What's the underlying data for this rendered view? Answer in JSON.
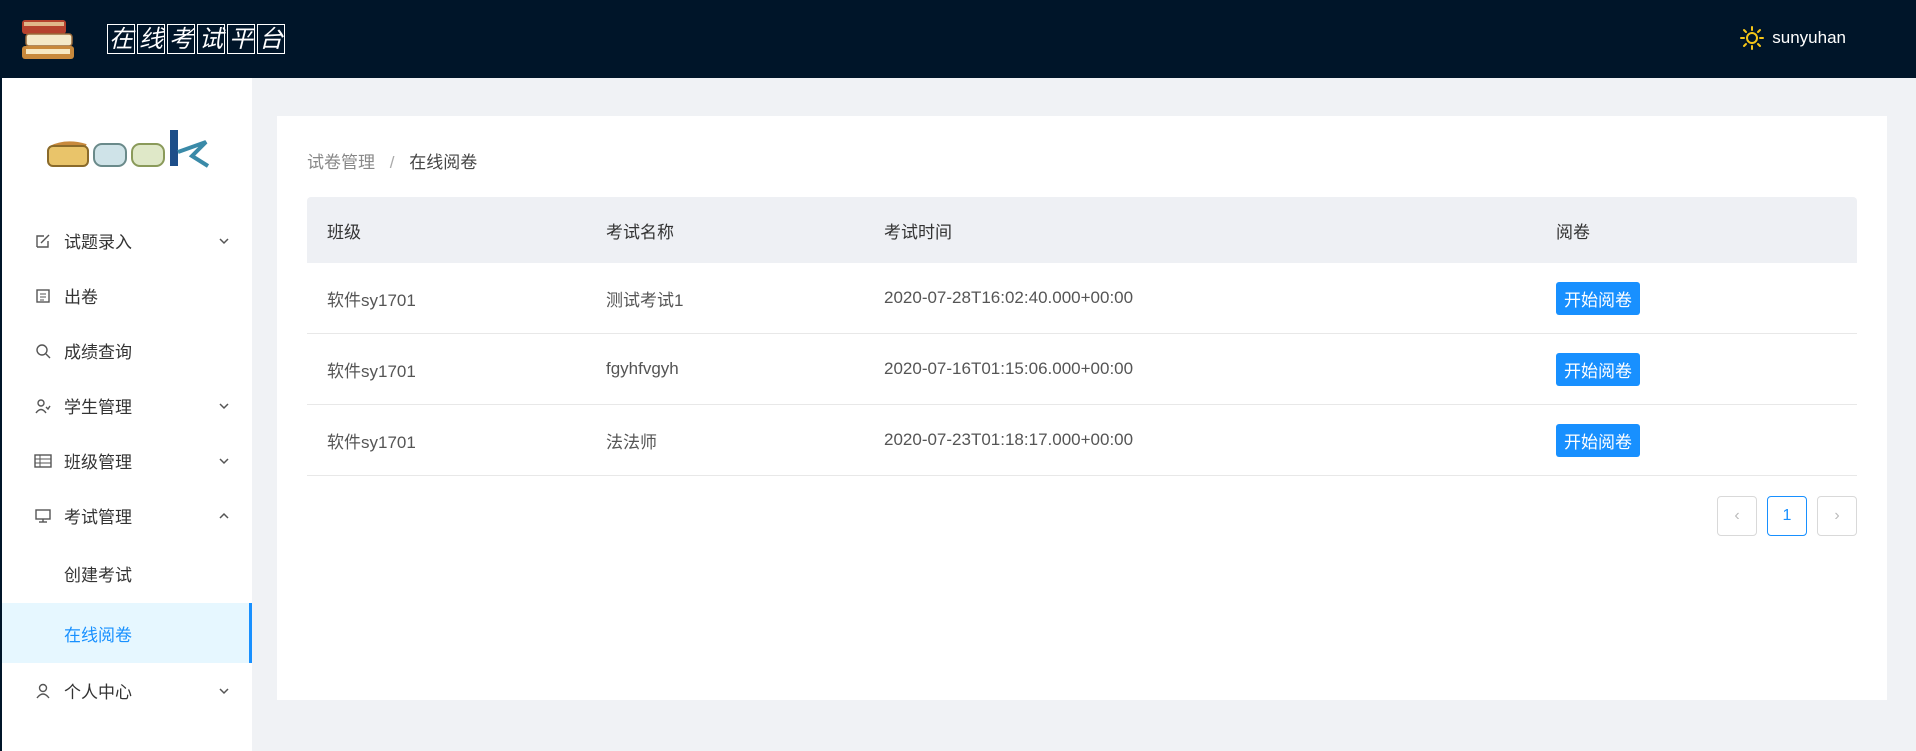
{
  "header": {
    "title_chars": [
      "在",
      "线",
      "考",
      "试",
      "平",
      "台"
    ],
    "username": "sunyuhan"
  },
  "sidebar": {
    "items": [
      {
        "label": "试题录入",
        "icon": "edit-icon",
        "expandable": true,
        "expanded": false
      },
      {
        "label": "出卷",
        "icon": "list-icon",
        "expandable": false
      },
      {
        "label": "成绩查询",
        "icon": "search-icon",
        "expandable": false
      },
      {
        "label": "学生管理",
        "icon": "user-manage-icon",
        "expandable": true,
        "expanded": false
      },
      {
        "label": "班级管理",
        "icon": "table-icon",
        "expandable": true,
        "expanded": false
      },
      {
        "label": "考试管理",
        "icon": "monitor-icon",
        "expandable": true,
        "expanded": true,
        "children": [
          {
            "label": "创建考试",
            "active": false
          },
          {
            "label": "在线阅卷",
            "active": true
          }
        ]
      },
      {
        "label": "个人中心",
        "icon": "person-icon",
        "expandable": true,
        "expanded": false
      }
    ]
  },
  "breadcrumb": {
    "parent": "试卷管理",
    "separator": "/",
    "current": "在线阅卷"
  },
  "table": {
    "columns": [
      "班级",
      "考试名称",
      "考试时间",
      "阅卷"
    ],
    "rows": [
      {
        "class": "软件sy1701",
        "exam": "测试考试1",
        "time": "2020-07-28T16:02:40.000+00:00",
        "action": "开始阅卷"
      },
      {
        "class": "软件sy1701",
        "exam": "fgyhfvgyh",
        "time": "2020-07-16T01:15:06.000+00:00",
        "action": "开始阅卷"
      },
      {
        "class": "软件sy1701",
        "exam": "法法师",
        "time": "2020-07-23T01:18:17.000+00:00",
        "action": "开始阅卷"
      }
    ]
  },
  "pagination": {
    "current_page": "1",
    "prev": "‹",
    "next": "›"
  },
  "colors": {
    "header_bg": "#001529",
    "accent": "#1890ff",
    "page_bg": "#f0f2f5"
  }
}
